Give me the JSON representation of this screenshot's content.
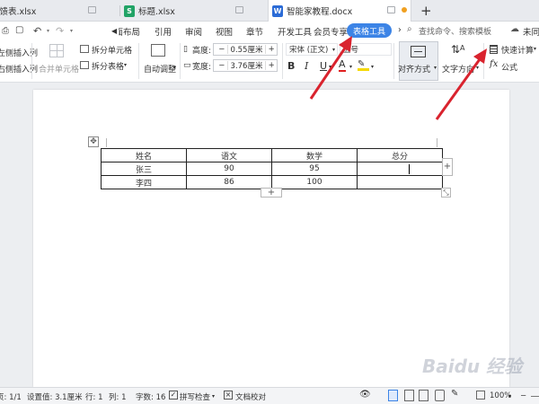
{
  "tabs": [
    {
      "label": "反馈表.xlsx"
    },
    {
      "label": "标题.xlsx",
      "icon_letter": "S"
    },
    {
      "label": "智能家教程.docx",
      "icon_letter": "W"
    }
  ],
  "add_tab": "+",
  "menu": {
    "items": [
      "页面布局",
      "引用",
      "审阅",
      "视图",
      "章节",
      "开发工具",
      "会员专享"
    ],
    "active_tool": "表格工具",
    "search_placeholder": "查找命令、搜索模板",
    "right_label": "未同"
  },
  "ribbon": {
    "insert_col_left": "在左侧插入列",
    "insert_col_right": "在右侧插入列",
    "merge_cells": "合并单元格",
    "split_cells": "拆分单元格",
    "split_table": "拆分表格",
    "auto_fit": "自动调整",
    "height_label": "高度:",
    "height_value": "0.55厘米",
    "width_label": "宽度:",
    "width_value": "3.76厘米",
    "minus": "−",
    "plus": "+",
    "font_name": "宋体 (正文)",
    "font_size": "五号",
    "bold": "B",
    "italic": "I",
    "underline": "U",
    "font_color": "A",
    "align_label": "对齐方式",
    "text_direction": "文字方向",
    "quick_calc": "快速计算",
    "formula": "公式",
    "fx": "fx"
  },
  "table": {
    "headers": [
      "姓名",
      "语文",
      "数学",
      "总分"
    ],
    "rows": [
      [
        "张三",
        "90",
        "95",
        ""
      ],
      [
        "李四",
        "86",
        "100",
        ""
      ]
    ],
    "add_row": "+",
    "add_col": "+"
  },
  "status": {
    "page": "页: 1/1",
    "setting": "设置值: 3.1厘米",
    "row": "行: 1",
    "col": "列: 1",
    "word_count": "字数: 16",
    "spell_check": "拼写检查",
    "proofread": "文档校对",
    "zoom": "100%"
  },
  "watermark": "Baidu 经验",
  "colors": {
    "accent": "#3c84e6",
    "arrow": "#d9232e",
    "excel_green": "#21a366",
    "word_blue": "#2b6bd6"
  }
}
